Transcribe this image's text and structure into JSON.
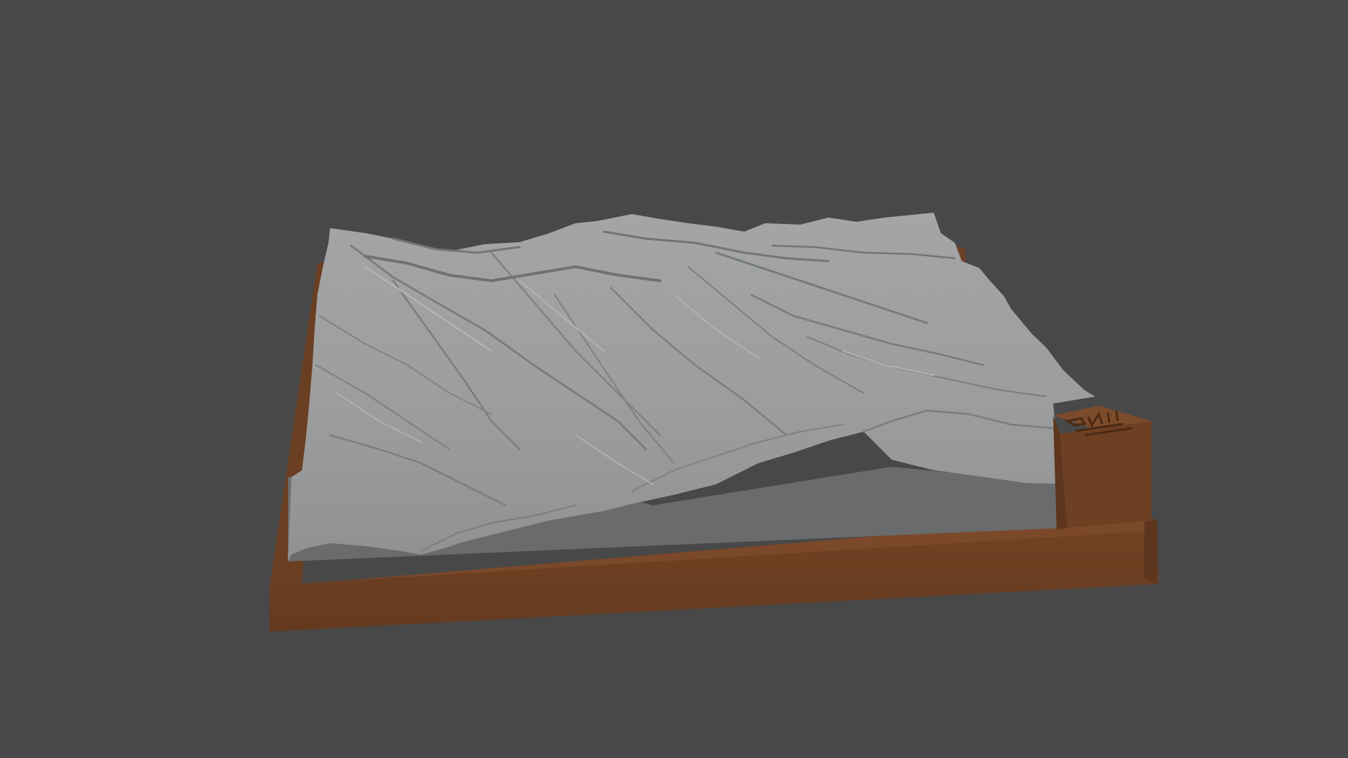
{
  "viewport": {
    "background_color": "#484848"
  },
  "model": {
    "terrain_color": "#9a9c9d",
    "terrain_highlight_color": "#b7b9ba",
    "terrain_shadow_color": "#6c6e70",
    "terrain_side_color": "#6a6b6c",
    "base_frame_color": "#6b3f22",
    "base_frame_top_color": "#7a4828",
    "base_frame_dark_color": "#5a331b",
    "tag_block_color": "#6d4023",
    "tag_block_top_color": "#7b4a2a"
  }
}
